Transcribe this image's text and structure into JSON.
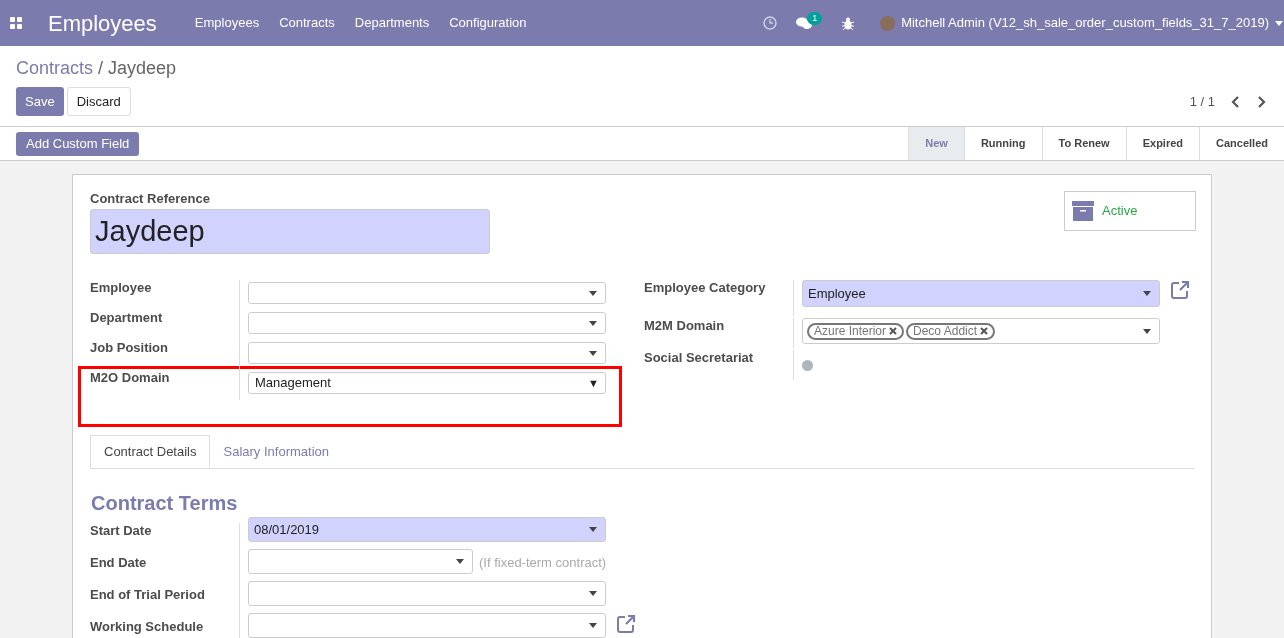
{
  "navbar": {
    "app_title": "Employees",
    "menu": [
      "Employees",
      "Contracts",
      "Departments",
      "Configuration"
    ],
    "messages_badge": "1",
    "user": "Mitchell Admin (V12_sh_sale_order_custom_fields_31_7_2019)"
  },
  "breadcrumb": {
    "parent": "Contracts",
    "separator": "/",
    "current": "Jaydeep"
  },
  "buttons": [
    {
      "label": "Save",
      "kind": "primary"
    },
    {
      "label": "Discard",
      "kind": "secondary"
    }
  ],
  "pager": "1 / 1",
  "add_custom_field": "Add Custom Field",
  "status_steps": [
    {
      "label": "New",
      "selected": true
    },
    {
      "label": "Running",
      "selected": false
    },
    {
      "label": "To Renew",
      "selected": false
    },
    {
      "label": "Expired",
      "selected": false
    },
    {
      "label": "Cancelled",
      "selected": false
    }
  ],
  "contract_reference": {
    "label": "Contract Reference",
    "value": "Jaydeep"
  },
  "active_button": "Active",
  "left_fields": [
    {
      "label": "Employee",
      "kind": "many2one",
      "required": false,
      "highlighted": false
    },
    {
      "label": "Department",
      "kind": "many2one",
      "required": false,
      "highlighted": false
    },
    {
      "label": "Job Position",
      "kind": "many2one",
      "required": false,
      "highlighted": false
    },
    {
      "label": "M2O Domain",
      "kind": "select",
      "value": "Management",
      "arrow": "▼",
      "required": false,
      "highlighted": true
    }
  ],
  "right_fields": [
    {
      "label": "Employee Category",
      "kind": "many2one",
      "value": "Employee",
      "required": true
    },
    {
      "label": "M2M Domain",
      "kind": "tags",
      "tags": [
        "Azure Interior",
        "Deco Addict"
      ]
    },
    {
      "label": "Social Secretariat",
      "kind": "toggle",
      "checked": false
    }
  ],
  "tabs": [
    {
      "label": "Contract Details",
      "selected": true
    },
    {
      "label": "Salary Information",
      "selected": false
    }
  ],
  "section_title": "Contract Terms",
  "terms_fields": [
    {
      "label": "Start Date",
      "kind": "date",
      "value": "08/01/2019",
      "required": true
    },
    {
      "label": "End Date",
      "kind": "date_short",
      "required": false,
      "hint": "(If fixed-term contract)"
    },
    {
      "label": "End of Trial Period",
      "kind": "date",
      "required": false
    },
    {
      "label": "Working Schedule",
      "kind": "many2one",
      "required": false
    }
  ]
}
